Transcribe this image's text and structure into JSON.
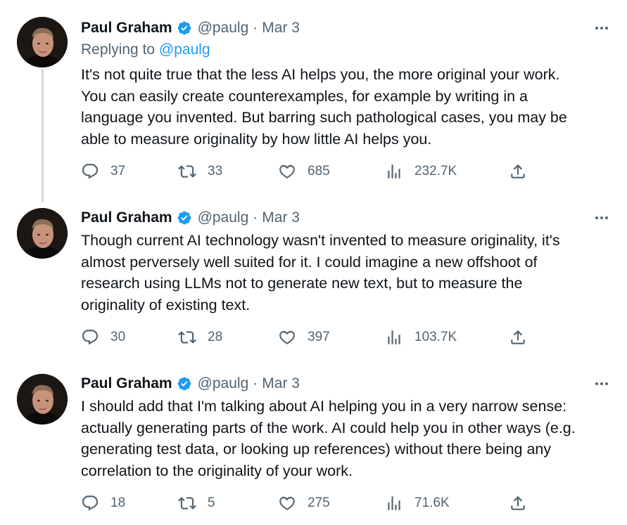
{
  "tweets": [
    {
      "author": {
        "name": "Paul Graham",
        "handle": "@paulg",
        "verified": true,
        "avatar": "avatar"
      },
      "date": "Mar 3",
      "reply_prefix": "Replying to",
      "reply_to": "@paulg",
      "lines": [
        "It's not quite true that the less AI helps you, the more original your work.",
        "You can easily create counterexamples, for example by writing in a",
        "language you invented. But barring such pathological cases, you may be",
        "able to measure originality by how little AI helps you."
      ],
      "replies": "37",
      "retweets": "33",
      "likes": "685",
      "views": "232.7K"
    },
    {
      "author": {
        "name": "Paul Graham",
        "handle": "@paulg",
        "verified": true,
        "avatar": "avatar"
      },
      "date": "Mar 3",
      "lines": [
        "Though current AI technology wasn't invented to measure originality, it's",
        "almost perversely well suited for it. I could imagine a new offshoot of",
        "research using LLMs not to generate new text, but to measure the",
        "originality of existing text."
      ],
      "replies": "30",
      "retweets": "28",
      "likes": "397",
      "views": "103.7K"
    },
    {
      "author": {
        "name": "Paul Graham",
        "handle": "@paulg",
        "verified": true,
        "avatar": "avatar"
      },
      "date": "Mar 3",
      "lines": [
        "I should add that I'm talking about AI helping you in a very narrow sense:",
        "actually generating parts of the work. AI could help you in other ways (e.g.",
        "generating test data, or looking up references) without there being any",
        "correlation to the originality of your work."
      ],
      "replies": "18",
      "retweets": "5",
      "likes": "275",
      "views": "71.6K"
    }
  ],
  "separator": "·",
  "colors": {
    "text": "#0f1419",
    "secondary": "#536471",
    "link": "#1d9bf0",
    "verified": "#1d9bf0",
    "thread_line": "#cfd9de"
  },
  "icons": [
    "verified-badge-icon",
    "more-icon",
    "reply-icon",
    "retweet-icon",
    "like-icon",
    "views-icon",
    "share-icon"
  ]
}
